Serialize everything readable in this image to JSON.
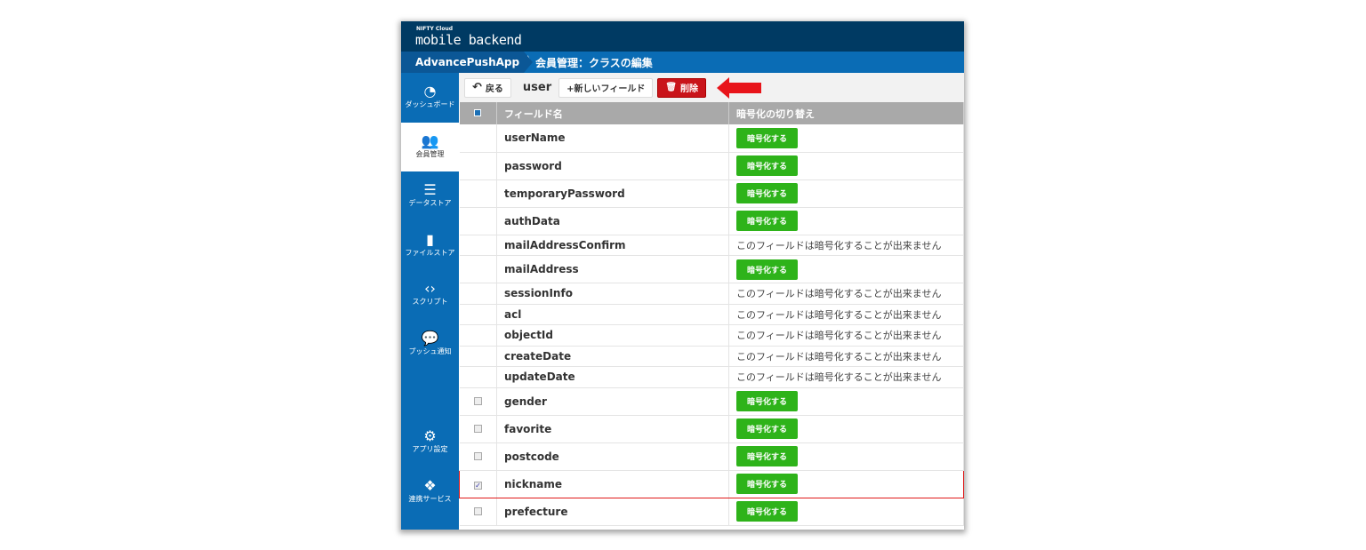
{
  "header": {
    "brand_small": "NIFTY Cloud",
    "brand": "mobile backend"
  },
  "breadcrumb": {
    "app": "AdvancePushApp",
    "page": "会員管理：クラスの編集"
  },
  "sidebar": {
    "items": [
      {
        "label": "ダッシュボード",
        "icon": "gauge-icon",
        "glyph": "◔"
      },
      {
        "label": "会員管理",
        "icon": "users-icon",
        "glyph": "👥"
      },
      {
        "label": "データストア",
        "icon": "database-icon",
        "glyph": "☰"
      },
      {
        "label": "ファイルストア",
        "icon": "file-icon",
        "glyph": "▮"
      },
      {
        "label": "スクリプト",
        "icon": "script-icon",
        "glyph": "‹›"
      },
      {
        "label": "プッシュ通知",
        "icon": "chat-icon",
        "glyph": "💬"
      },
      {
        "label": "",
        "icon": "",
        "glyph": ""
      },
      {
        "label": "アプリ設定",
        "icon": "gear-icon",
        "glyph": "⚙"
      },
      {
        "label": "連携サービス",
        "icon": "cubes-icon",
        "glyph": "❖"
      }
    ],
    "active": 1
  },
  "toolbar": {
    "back": "戻る",
    "class_name": "user",
    "new_field": "+新しいフィールド",
    "delete": "削除"
  },
  "table": {
    "headers": [
      "フィールド名",
      "暗号化の切り替え"
    ],
    "encrypt_label": "暗号化する",
    "no_encrypt": "このフィールドは暗号化することが出来ません",
    "rows": [
      {
        "name": "userName",
        "checkbox": false,
        "selectable": false,
        "encryptable": true
      },
      {
        "name": "password",
        "checkbox": false,
        "selectable": false,
        "encryptable": true
      },
      {
        "name": "temporaryPassword",
        "checkbox": false,
        "selectable": false,
        "encryptable": true
      },
      {
        "name": "authData",
        "checkbox": false,
        "selectable": false,
        "encryptable": true
      },
      {
        "name": "mailAddressConfirm",
        "checkbox": false,
        "selectable": false,
        "encryptable": false
      },
      {
        "name": "mailAddress",
        "checkbox": false,
        "selectable": false,
        "encryptable": true
      },
      {
        "name": "sessionInfo",
        "checkbox": false,
        "selectable": false,
        "encryptable": false
      },
      {
        "name": "acl",
        "checkbox": false,
        "selectable": false,
        "encryptable": false
      },
      {
        "name": "objectId",
        "checkbox": false,
        "selectable": false,
        "encryptable": false
      },
      {
        "name": "createDate",
        "checkbox": false,
        "selectable": false,
        "encryptable": false
      },
      {
        "name": "updateDate",
        "checkbox": false,
        "selectable": false,
        "encryptable": false
      },
      {
        "name": "gender",
        "checkbox": false,
        "selectable": true,
        "encryptable": true
      },
      {
        "name": "favorite",
        "checkbox": false,
        "selectable": true,
        "encryptable": true
      },
      {
        "name": "postcode",
        "checkbox": false,
        "selectable": true,
        "encryptable": true
      },
      {
        "name": "nickname",
        "checkbox": true,
        "selectable": true,
        "encryptable": true,
        "highlighted": true
      },
      {
        "name": "prefecture",
        "checkbox": false,
        "selectable": true,
        "encryptable": true
      }
    ]
  },
  "colors": {
    "header": "#003a63",
    "accent": "#0a6cb5",
    "encrypt": "#2eb31a",
    "delete": "#c9141a",
    "highlight": "#e01a1a"
  }
}
